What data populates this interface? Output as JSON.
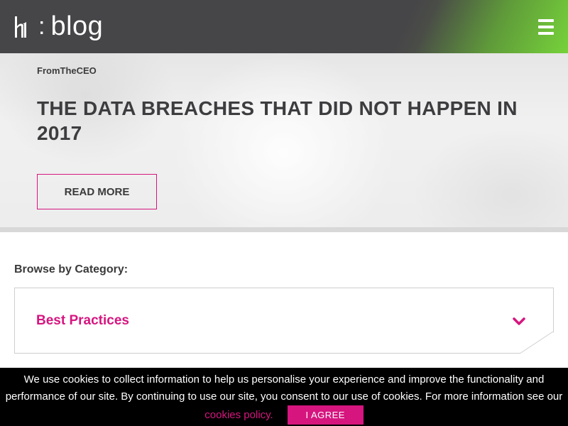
{
  "header": {
    "logo_colon": ":",
    "logo_text": "blog",
    "menu_icon": "hamburger-menu-icon"
  },
  "hero": {
    "tag": "FromTheCEO",
    "title": "THE DATA BREACHES THAT DID NOT HAPPEN IN 2017",
    "read_more_label": "READ MORE"
  },
  "browse": {
    "label": "Browse by Category:",
    "selected_category": "Best Practices",
    "chevron_icon": "chevron-down-icon"
  },
  "cookie_banner": {
    "text": "We use cookies to collect information to help us personalise your experience and improve the functionality and performance of our site. By continuing to use our site, you consent to our use of cookies. For more information see our",
    "link_label": "cookies policy.",
    "agree_label": "I AGREE"
  },
  "colors": {
    "accent": "#d6157f",
    "header_bg": "#464548",
    "header_green": "#76d23a",
    "cookie_bg": "#000000"
  }
}
